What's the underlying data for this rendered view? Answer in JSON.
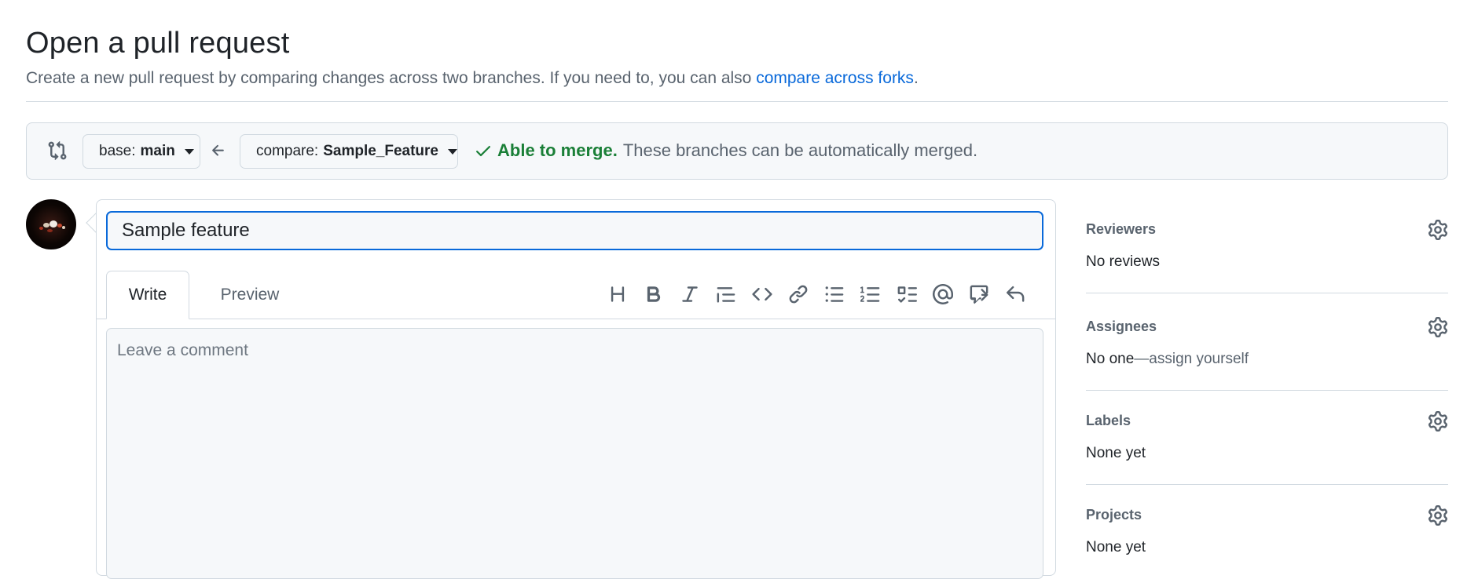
{
  "header": {
    "title": "Open a pull request",
    "subtitle": "Create a new pull request by comparing changes across two branches. If you need to, you can also ",
    "compare_forks_link": "compare across forks",
    "subtitle_end": "."
  },
  "compare": {
    "base_prefix": "base: ",
    "base_branch": "main",
    "compare_prefix": "compare: ",
    "compare_branch": "Sample_Feature",
    "merge_ok": "Able to merge.",
    "merge_text": "These branches can be automatically merged."
  },
  "editor": {
    "title_value": "Sample feature",
    "tab_write": "Write",
    "tab_preview": "Preview",
    "comment_placeholder": "Leave a comment",
    "toolbar": [
      "heading-icon",
      "bold-icon",
      "italic-icon",
      "quote-icon",
      "code-icon",
      "link-icon",
      "unordered-list-icon",
      "ordered-list-icon",
      "task-list-icon",
      "mention-icon",
      "reference-icon",
      "undo-icon"
    ]
  },
  "sidebar": {
    "reviewers": {
      "label": "Reviewers",
      "value": "No reviews"
    },
    "assignees": {
      "label": "Assignees",
      "value_prefix": "No one",
      "value_link": "—assign yourself"
    },
    "labels": {
      "label": "Labels",
      "value": "None yet"
    },
    "projects": {
      "label": "Projects",
      "value": "None yet"
    }
  },
  "colors": {
    "accent": "#0969da",
    "success": "#1a7f37",
    "muted": "#59636e",
    "border": "#d1d9e0"
  }
}
